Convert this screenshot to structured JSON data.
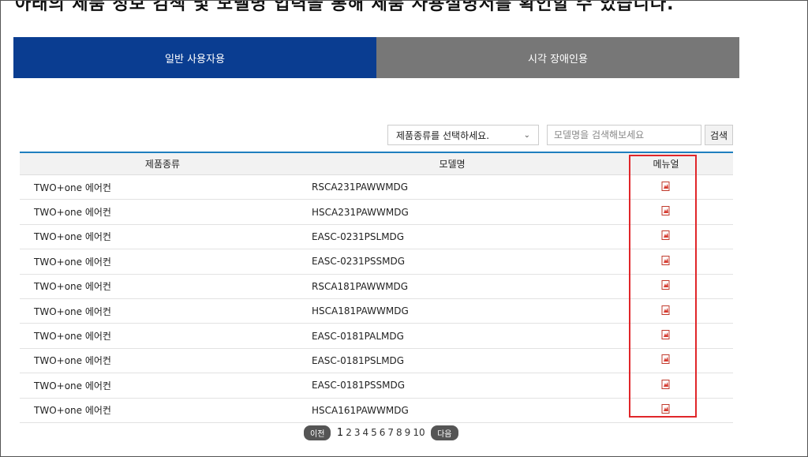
{
  "cut_heading": "아래의 제품 정보 검색 및 모델명 입력을 통해 제품 사용설명서를 확인할 수 있습니다.",
  "tabs": [
    {
      "label": "일반 사용자용",
      "active": true
    },
    {
      "label": "시각 장애인용",
      "active": false
    }
  ],
  "filters": {
    "select_value": "제품종류를 선택하세요.",
    "search_placeholder": "모델명을 검색해보세요",
    "search_button": "검색"
  },
  "table": {
    "headers": [
      "제품종류",
      "모델명",
      "메뉴얼"
    ],
    "rows": [
      {
        "type": "TWO+one 에어컨",
        "model": "RSCA231PAWWMDG"
      },
      {
        "type": "TWO+one 에어컨",
        "model": "HSCA231PAWWMDG"
      },
      {
        "type": "TWO+one 에어컨",
        "model": "EASC-0231PSLMDG"
      },
      {
        "type": "TWO+one 에어컨",
        "model": "EASC-0231PSSMDG"
      },
      {
        "type": "TWO+one 에어컨",
        "model": "RSCA181PAWWMDG"
      },
      {
        "type": "TWO+one 에어컨",
        "model": "HSCA181PAWWMDG"
      },
      {
        "type": "TWO+one 에어컨",
        "model": "EASC-0181PALMDG"
      },
      {
        "type": "TWO+one 에어컨",
        "model": "EASC-0181PSLMDG"
      },
      {
        "type": "TWO+one 에어컨",
        "model": "EASC-0181PSSMDG"
      },
      {
        "type": "TWO+one 에어컨",
        "model": "HSCA161PAWWMDG"
      }
    ],
    "manual_icon": "pdf-icon"
  },
  "pagination": {
    "prev": "이전",
    "next": "다음",
    "pages": [
      "1",
      "2",
      "3",
      "4",
      "5",
      "6",
      "7",
      "8",
      "9",
      "10"
    ],
    "current": "1"
  },
  "colors": {
    "active_tab": "#0a3d91",
    "inactive_tab": "#777777",
    "table_top_border": "#1f7fbf",
    "highlight": "#e0262a"
  }
}
